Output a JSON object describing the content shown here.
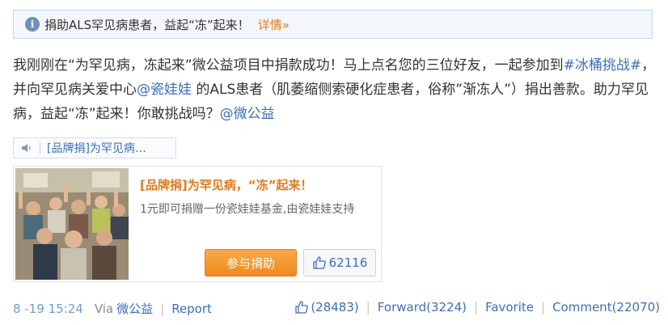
{
  "notice": {
    "text": "捐助ALS罕见病患者，益起“冻”起来！",
    "detail_label": "详情»",
    "icon": "info-icon"
  },
  "post": {
    "part1": "我刚刚在“为罕见病，冻起来”微公益项目中捐款成功！马上点名您的三位好友，一起参加到",
    "hashtag": "#冰桶挑战#",
    "part2": "，并向罕见病关爱中心",
    "mention1": "@瓷娃娃",
    "part3": " 的ALS患者（肌萎缩侧索硬化症患者，俗称”渐冻人”）捐出善款。助力罕见病，益起“冻”起来！你敢挑战吗？",
    "mention2": "@微公益"
  },
  "link_chip": {
    "label": "[品牌捐]为罕见病…",
    "icon": "link-icon"
  },
  "card": {
    "title": "[品牌捐]为罕见病，“冻”起来！",
    "description": "1元即可捐赠一份瓷娃娃基金,由瓷娃娃支持",
    "join_label": "参与捐助",
    "like_count": "62116",
    "image": "group-photo"
  },
  "footer": {
    "timestamp": "8 -19 15:24",
    "via_label": "Via",
    "source": "微公益",
    "report_label": "Report",
    "like_count": "(28483)",
    "forward_label": "Forward(3224)",
    "favorite_label": "Favorite",
    "comment_label": "Comment(22070)"
  },
  "colors": {
    "link": "#3b6fb6",
    "accent": "#e07a1f",
    "button": "#ef8a1c"
  }
}
